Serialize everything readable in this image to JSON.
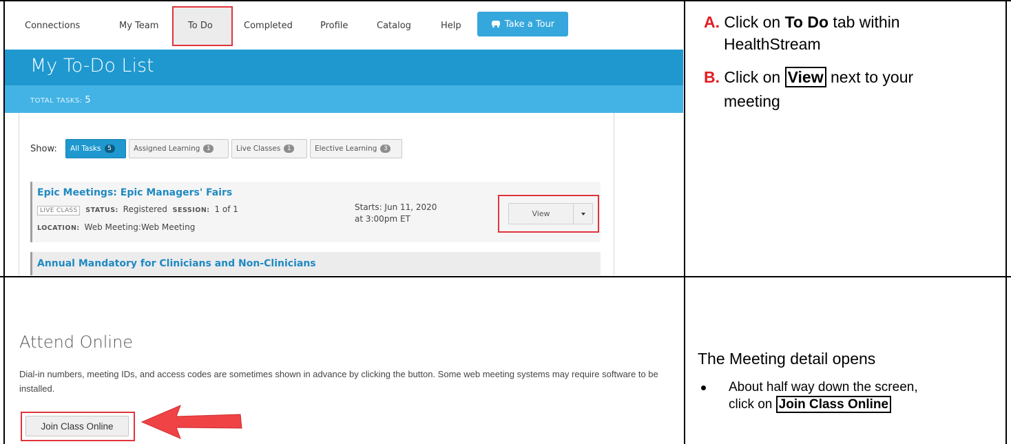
{
  "nav": {
    "items": [
      {
        "label": "Connections"
      },
      {
        "label": "My Team"
      },
      {
        "label": "To Do"
      },
      {
        "label": "Completed"
      },
      {
        "label": "Profile"
      },
      {
        "label": "Catalog"
      },
      {
        "label": "Help"
      }
    ],
    "tour_label": "Take a Tour"
  },
  "page": {
    "title": "My To-Do List",
    "total_label": "TOTAL TASKS:",
    "total_value": "5"
  },
  "filters": {
    "show_label": "Show:",
    "chips": [
      {
        "label": "All Tasks",
        "count": "5",
        "active": true
      },
      {
        "label": "Assigned Learning",
        "count": "1",
        "active": false
      },
      {
        "label": "Live Classes",
        "count": "1",
        "active": false
      },
      {
        "label": "Elective Learning",
        "count": "3",
        "active": false
      }
    ]
  },
  "tasks": [
    {
      "title": "Epic Meetings: Epic Managers' Fairs",
      "tag": "LIVE CLASS",
      "status_label": "STATUS:",
      "status_value": "Registered",
      "session_label": "SESSION:",
      "session_value": "1 of 1",
      "location_label": "LOCATION:",
      "location_value": "Web Meeting:Web Meeting",
      "starts_line1": "Starts: Jun 11, 2020",
      "starts_line2": "at 3:00pm ET",
      "view_label": "View"
    },
    {
      "title": "Annual Mandatory for Clinicians and Non-Clinicians"
    }
  ],
  "instructions_top": {
    "a_letter": "A.",
    "a_pre": "Click on ",
    "a_bold": "To Do",
    "a_post": " tab within",
    "a_line2": "HealthStream",
    "b_letter": "B.",
    "b_pre": "Click on ",
    "b_boxed": "View",
    "b_post": " next to your",
    "b_line2": "meeting"
  },
  "attend": {
    "title": "Attend Online",
    "description": "Dial-in numbers, meeting IDs, and access codes are sometimes shown in advance by clicking the button. Some web meeting systems may require software to be installed.",
    "join_label": "Join Class Online"
  },
  "instructions_bottom": {
    "heading": "The Meeting detail opens",
    "bullet_line1": "About half way down the screen,",
    "bullet_pre": "click on ",
    "bullet_boxed": "Join Class Online"
  },
  "colors": {
    "brand_blue": "#1f98cf",
    "light_blue": "#42b3e4",
    "highlight_red": "#e0333b",
    "letter_red": "#e31b23"
  }
}
